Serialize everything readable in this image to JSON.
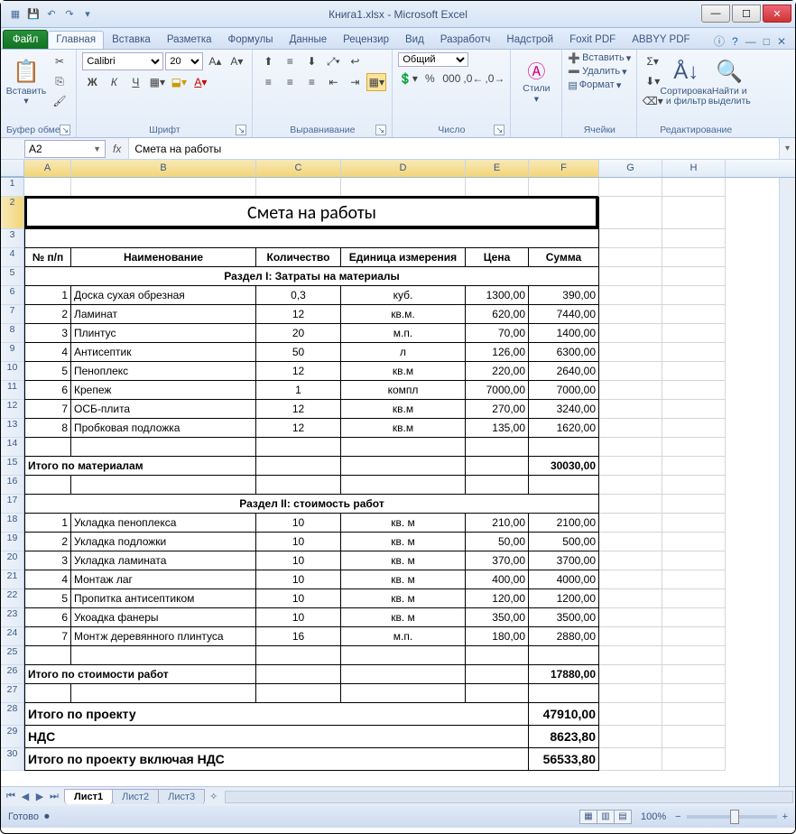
{
  "window": {
    "title": "Книга1.xlsx  -  Microsoft Excel"
  },
  "tabs": {
    "file": "Файл",
    "items": [
      "Главная",
      "Вставка",
      "Разметка",
      "Формулы",
      "Данные",
      "Рецензир",
      "Вид",
      "Разработч",
      "Надстрой",
      "Foxit PDF",
      "ABBYY PDF"
    ],
    "active": 0
  },
  "ribbon": {
    "clipboard": {
      "paste": "Вставить",
      "label": "Буфер обмена"
    },
    "font": {
      "name": "Calibri",
      "size": "20",
      "label": "Шрифт"
    },
    "align": {
      "label": "Выравнивание"
    },
    "number": {
      "format": "Общий",
      "label": "Число"
    },
    "styles": {
      "btn": "Стили",
      "label": ""
    },
    "cells": {
      "insert": "Вставить",
      "delete": "Удалить",
      "format": "Формат",
      "label": "Ячейки"
    },
    "editing": {
      "sort": "Сортировка и фильтр",
      "find": "Найти и выделить",
      "label": "Редактирование"
    }
  },
  "formula_bar": {
    "cell_ref": "A2",
    "fx": "fx",
    "value": "Смета на работы"
  },
  "columns": [
    "A",
    "B",
    "C",
    "D",
    "E",
    "F",
    "G",
    "H"
  ],
  "sheet": {
    "title": "Смета на работы",
    "headers": {
      "num": "№ п/п",
      "name": "Наименование",
      "qty": "Количество",
      "unit": "Единица измерения",
      "price": "Цена",
      "sum": "Сумма"
    },
    "section1": "Раздел I: Затраты на материалы",
    "rows1": [
      {
        "n": "1",
        "name": "Доска сухая обрезная",
        "q": "0,3",
        "u": "куб.",
        "p": "1300,00",
        "s": "390,00"
      },
      {
        "n": "2",
        "name": "Ламинат",
        "q": "12",
        "u": "кв.м.",
        "p": "620,00",
        "s": "7440,00"
      },
      {
        "n": "3",
        "name": "Плинтус",
        "q": "20",
        "u": "м.п.",
        "p": "70,00",
        "s": "1400,00"
      },
      {
        "n": "4",
        "name": "Антисептик",
        "q": "50",
        "u": "л",
        "p": "126,00",
        "s": "6300,00"
      },
      {
        "n": "5",
        "name": "Пеноплекс",
        "q": "12",
        "u": "кв.м",
        "p": "220,00",
        "s": "2640,00"
      },
      {
        "n": "6",
        "name": "Крепеж",
        "q": "1",
        "u": "компл",
        "p": "7000,00",
        "s": "7000,00"
      },
      {
        "n": "7",
        "name": "ОСБ-плита",
        "q": "12",
        "u": "кв.м",
        "p": "270,00",
        "s": "3240,00"
      },
      {
        "n": "8",
        "name": "Пробковая подложка",
        "q": "12",
        "u": "кв.м",
        "p": "135,00",
        "s": "1620,00"
      }
    ],
    "subtotal1": {
      "label": "Итого по материалам",
      "value": "30030,00"
    },
    "section2": "Раздел II: стоимость работ",
    "rows2": [
      {
        "n": "1",
        "name": "Укладка пеноплекса",
        "q": "10",
        "u": "кв. м",
        "p": "210,00",
        "s": "2100,00"
      },
      {
        "n": "2",
        "name": "Укладка подложки",
        "q": "10",
        "u": "кв. м",
        "p": "50,00",
        "s": "500,00"
      },
      {
        "n": "3",
        "name": "Укладка  ламината",
        "q": "10",
        "u": "кв. м",
        "p": "370,00",
        "s": "3700,00"
      },
      {
        "n": "4",
        "name": "Монтаж лаг",
        "q": "10",
        "u": "кв. м",
        "p": "400,00",
        "s": "4000,00"
      },
      {
        "n": "5",
        "name": "Пропитка антисептиком",
        "q": "10",
        "u": "кв. м",
        "p": "120,00",
        "s": "1200,00"
      },
      {
        "n": "6",
        "name": "Укоадка фанеры",
        "q": "10",
        "u": "кв. м",
        "p": "350,00",
        "s": "3500,00"
      },
      {
        "n": "7",
        "name": "Монтж деревянного плинтуса",
        "q": "16",
        "u": "м.п.",
        "p": "180,00",
        "s": "2880,00"
      }
    ],
    "subtotal2": {
      "label": "Итого по стоимости работ",
      "value": "17880,00"
    },
    "totals": [
      {
        "label": "Итого по проекту",
        "value": "47910,00"
      },
      {
        "label": "НДС",
        "value": "8623,80"
      },
      {
        "label": "Итого по проекту включая НДС",
        "value": "56533,80"
      }
    ]
  },
  "sheets": {
    "tabs": [
      "Лист1",
      "Лист2",
      "Лист3"
    ],
    "active": 0
  },
  "status": {
    "ready": "Готово",
    "zoom": "100%"
  }
}
